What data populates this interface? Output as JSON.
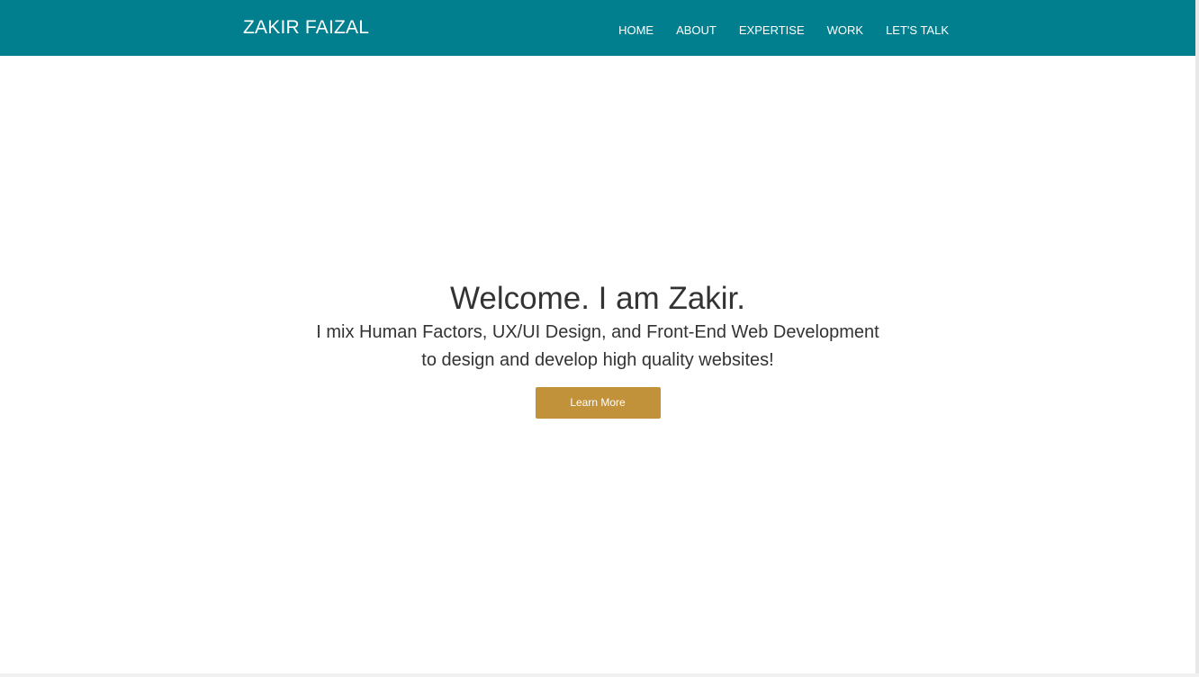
{
  "header": {
    "brand": "ZAKIR FAIZAL",
    "nav_items": [
      {
        "label": "HOME"
      },
      {
        "label": "ABOUT"
      },
      {
        "label": "EXPERTISE"
      },
      {
        "label": "WORK"
      },
      {
        "label": "LET'S TALK"
      }
    ]
  },
  "hero": {
    "title": "Welcome. I am Zakir.",
    "description_line_1": "I mix Human Factors, UX/UI Design, and Front-End Web Development",
    "description_line_2": "to design and develop high quality websites!",
    "button_label": "Learn More"
  },
  "colors": {
    "header_background": "#017f8e",
    "accent_button": "#c2923a",
    "text": "#333333",
    "background": "#ffffff"
  }
}
